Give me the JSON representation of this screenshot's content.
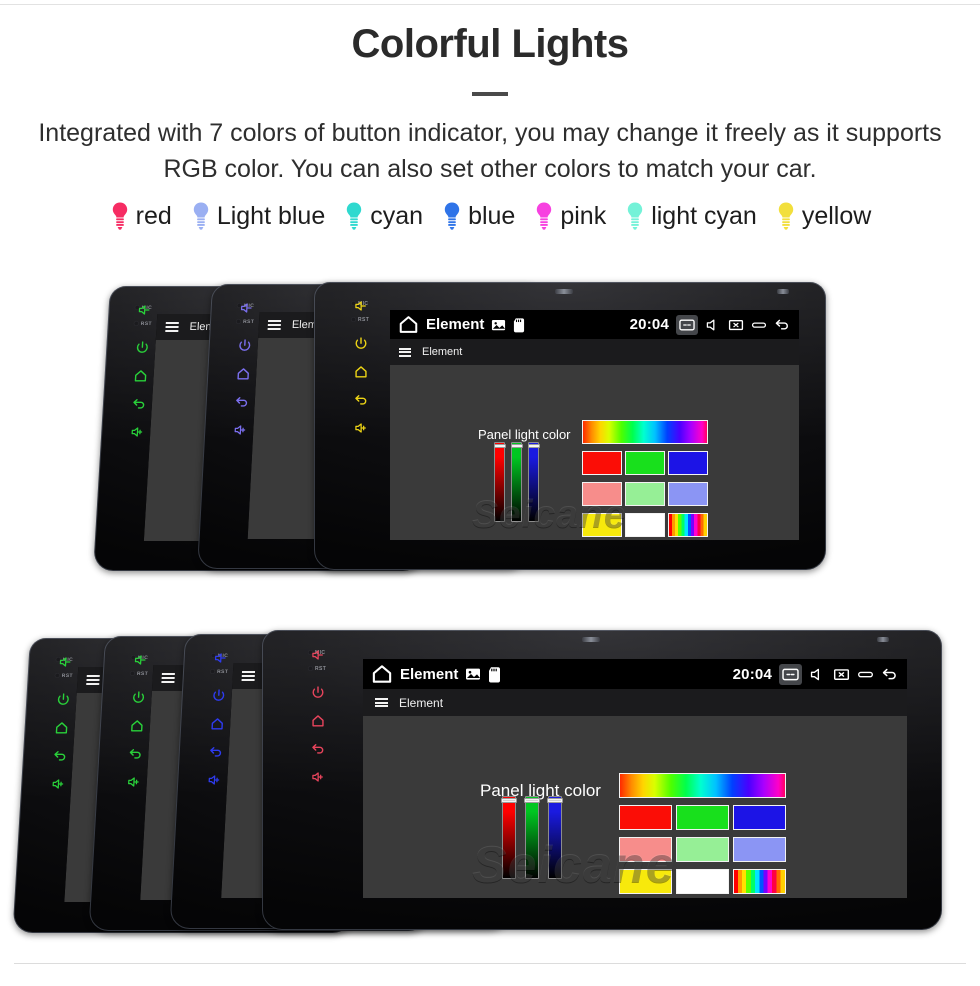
{
  "header": {
    "title": "Colorful Lights",
    "subtitle": "Integrated with 7 colors of button indicator, you may change it freely as it supports RGB color. You can also set other colors to match your car."
  },
  "legend": {
    "items": [
      {
        "label": "red",
        "color": "#f62c63",
        "icon": "bulb-icon"
      },
      {
        "label": "Light blue",
        "color": "#9aaff2",
        "icon": "bulb-icon"
      },
      {
        "label": "cyan",
        "color": "#2fd9cf",
        "icon": "bulb-icon"
      },
      {
        "label": "blue",
        "color": "#2f74e8",
        "icon": "bulb-icon"
      },
      {
        "label": "pink",
        "color": "#f741e0",
        "icon": "bulb-icon"
      },
      {
        "label": "light cyan",
        "color": "#74f2d8",
        "icon": "bulb-icon"
      },
      {
        "label": "yellow",
        "color": "#f2df3c",
        "icon": "bulb-icon"
      }
    ]
  },
  "device": {
    "button_panel": {
      "mic_label": "MIC",
      "rst_label": "RST",
      "keys": [
        {
          "name": "power-key",
          "icon": "power-icon"
        },
        {
          "name": "home-key",
          "icon": "home-outline-icon"
        },
        {
          "name": "back-key",
          "icon": "back-arrow-icon"
        },
        {
          "name": "volume-up-key",
          "icon": "volume-up-icon"
        },
        {
          "name": "volume-down-key",
          "icon": "volume-down-icon"
        }
      ]
    },
    "statusbar": {
      "home_icon": "home-icon",
      "title": "Element",
      "image_icon": "picture-icon",
      "sd_icon": "sd-card-icon",
      "time": "20:04",
      "right_icons": [
        {
          "name": "screen-off-icon",
          "active": true
        },
        {
          "name": "mute-icon",
          "active": false
        },
        {
          "name": "close-window-icon",
          "active": false
        },
        {
          "name": "recents-icon",
          "active": false
        },
        {
          "name": "back-icon",
          "active": false
        }
      ]
    },
    "appbar": {
      "menu_icon": "hamburger-menu-icon",
      "title": "Element"
    },
    "panel_light": {
      "label": "Panel light color",
      "sliders": [
        {
          "name": "red-channel-slider",
          "color": "#ff0000",
          "value": 100
        },
        {
          "name": "green-channel-slider",
          "color": "#00c621",
          "value": 100
        },
        {
          "name": "blue-channel-slider",
          "color": "#1a1ae0",
          "value": 100
        }
      ],
      "swatch_bar": {
        "name": "hue-spectrum-swatch",
        "type": "rainbow"
      },
      "swatches": [
        {
          "name": "swatch-red",
          "color": "#fb0d06"
        },
        {
          "name": "swatch-green",
          "color": "#18e01c"
        },
        {
          "name": "swatch-blue",
          "color": "#1c14e6"
        },
        {
          "name": "swatch-salmon",
          "color": "#f78d8b"
        },
        {
          "name": "swatch-light-green",
          "color": "#96ef96"
        },
        {
          "name": "swatch-periwinkle",
          "color": "#8b95f4"
        },
        {
          "name": "swatch-yellow",
          "color": "#f7e90c"
        },
        {
          "name": "swatch-white",
          "color": "#ffffff"
        },
        {
          "name": "swatch-rainbow",
          "type": "rainbow-stripes"
        }
      ]
    },
    "watermark": "Seicane"
  },
  "clusters": {
    "top": {
      "name": "top-device-stack",
      "units": [
        {
          "name": "device-green",
          "led_color": "#29d13a"
        },
        {
          "name": "device-violet",
          "led_color": "#7b6ff0"
        },
        {
          "name": "device-yellow",
          "led_color": "#edd415"
        }
      ]
    },
    "bottom": {
      "name": "bottom-device-stack",
      "units": [
        {
          "name": "device-green-1",
          "led_color": "#29d13a"
        },
        {
          "name": "device-green-2",
          "led_color": "#29d13a"
        },
        {
          "name": "device-blue",
          "led_color": "#2e3bf0"
        },
        {
          "name": "device-red",
          "led_color": "#e8445c"
        }
      ]
    }
  }
}
